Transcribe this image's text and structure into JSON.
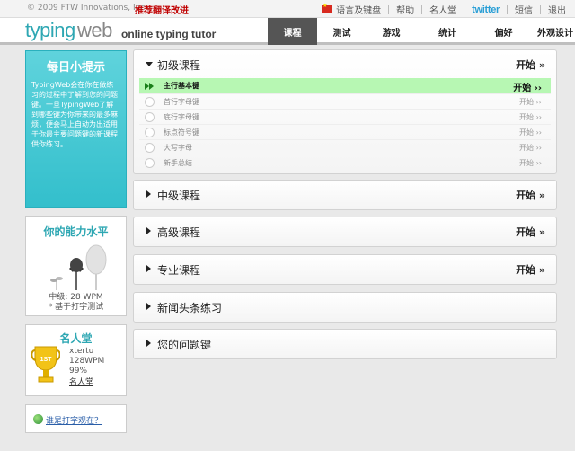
{
  "topbar": {
    "copyright": "© 2009 FTW Innovations, Inc.",
    "promo": "推荐翻译改进",
    "links": [
      "语言及键盘",
      "帮助",
      "名人堂",
      "twitter",
      "短信",
      "退出"
    ]
  },
  "header": {
    "logo_typing": "typing",
    "logo_web": "web",
    "tagline": "online typing tutor",
    "nav": [
      "课程",
      "测试",
      "游戏",
      "统计",
      "偏好",
      "外观设计"
    ]
  },
  "sidebar": {
    "tip": {
      "title": "每日小提示",
      "text": "TypingWeb会在你在做练习的过程中了解到您的问题键。一旦TypingWeb了解到哪些键为你带来的最多麻烦，便会马上自动为出适用于你最主要问题键的新课程供你练习。"
    },
    "ability": {
      "title": "你的能力水平",
      "level": "中级: 28 WPM",
      "note": "* 基于打字测试"
    },
    "fame": {
      "title": "名人堂",
      "user": "xtertu",
      "wpm": "128WPM",
      "accuracy": "99%",
      "link": "名人堂",
      "badge": "1ST"
    },
    "typing_link": "谁是打字观在？"
  },
  "courses": {
    "beginner": {
      "title": "初级课程",
      "start": "开始 »",
      "lessons": [
        {
          "title": "主行基本键",
          "start": "开始 ››"
        },
        {
          "title": "首行字母键",
          "start": "开始 ››"
        },
        {
          "title": "底行字母键",
          "start": "开始 ››"
        },
        {
          "title": "标点符号键",
          "start": "开始 ››"
        },
        {
          "title": "大写字母",
          "start": "开始 ››"
        },
        {
          "title": "新手总结",
          "start": "开始 ››"
        }
      ]
    },
    "intermediate": {
      "title": "中级课程",
      "start": "开始 »"
    },
    "advanced": {
      "title": "高级课程",
      "start": "开始 »"
    },
    "professional": {
      "title": "专业课程",
      "start": "开始 »"
    },
    "news": {
      "title": "新闻头条练习"
    },
    "problem_keys": {
      "title": "您的问题键"
    }
  }
}
